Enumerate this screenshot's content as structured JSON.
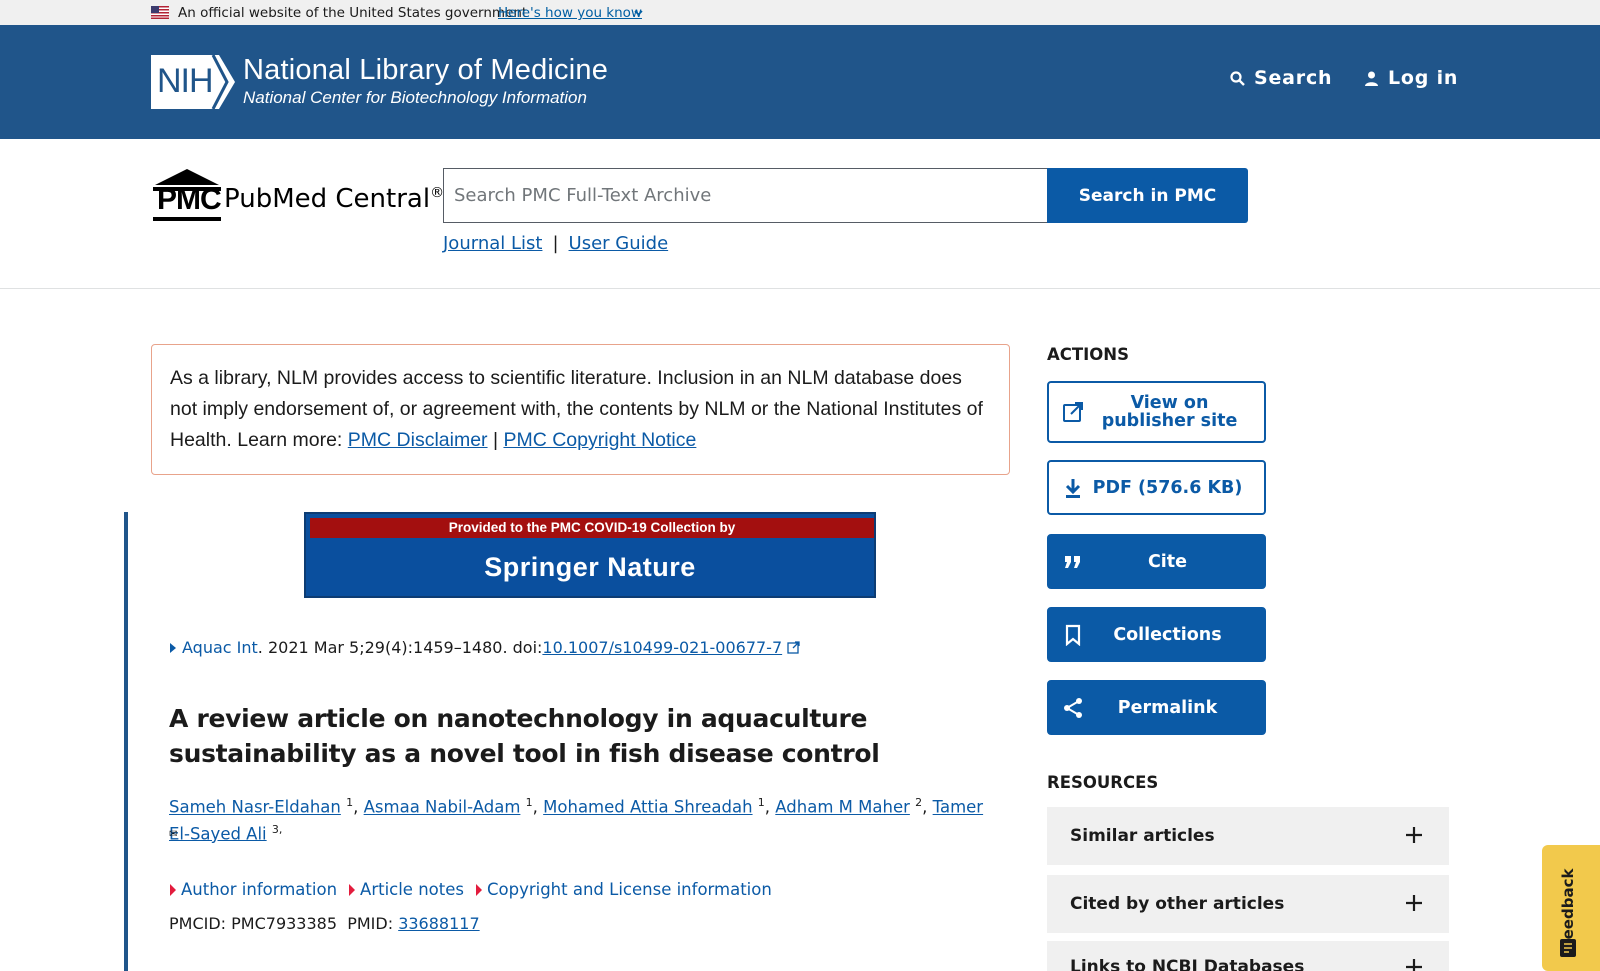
{
  "gov_banner": {
    "text": "An official website of the United States government",
    "link": "Here's how you know"
  },
  "header": {
    "nih_badge": "NIH",
    "title": "National Library of Medicine",
    "subtitle": "National Center for Biotechnology Information",
    "search_label": "Search",
    "login_label": "Log in",
    "background": "#20558a"
  },
  "pmc": {
    "logo_text": "PMC",
    "name": "PubMed Central",
    "name_mark": "®",
    "search_placeholder": "Search PMC Full-Text Archive",
    "search_button": "Search in PMC",
    "journal_list": "Journal List",
    "separator": "|",
    "user_guide": "User Guide"
  },
  "disclaimer": {
    "text": "As a library, NLM provides access to scientific literature. Inclusion in an NLM database does not imply endorsement of, or agreement with, the contents by NLM or the National Institutes of Health.",
    "learn_more": "Learn more:",
    "link1": "PMC Disclaimer",
    "sep": "|",
    "link2": "PMC Copyright Notice"
  },
  "covid_banner": {
    "top": "Provided to the PMC COVID-19 Collection by",
    "name": "Springer Nature"
  },
  "article": {
    "journal": "Aquac Int",
    "citation": ". 2021 Mar 5;29(4):1459–1480. doi: ",
    "doi": "10.1007/s10499-021-00677-7",
    "title": "A review article on nanotechnology in aquaculture sustainability as a novel tool in fish disease control",
    "authors": [
      {
        "name": "Sameh Nasr-Eldahan",
        "sup": "1"
      },
      {
        "name": "Asmaa Nabil-Adam",
        "sup": "1"
      },
      {
        "name": "Mohamed Attia Shreadah",
        "sup": "1"
      },
      {
        "name": "Adham M Maher",
        "sup": "2"
      },
      {
        "name": "Tamer El-Sayed Ali",
        "sup": "3,"
      }
    ],
    "envelope": "✉",
    "sections": [
      "Author information",
      "Article notes",
      "Copyright and License information"
    ],
    "pmcid_label": "PMCID: PMC7933385",
    "pmid_label": "PMID:",
    "pmid": "33688117"
  },
  "sidebar": {
    "actions_heading": "ACTIONS",
    "view_publisher": "View on publisher site",
    "pdf": "PDF (576.6 KB)",
    "cite": "Cite",
    "collections": "Collections",
    "permalink": "Permalink",
    "resources_heading": "RESOURCES",
    "resources": [
      "Similar articles",
      "Cited by other articles",
      "Links to NCBI Databases"
    ]
  },
  "feedback": "Feedback"
}
